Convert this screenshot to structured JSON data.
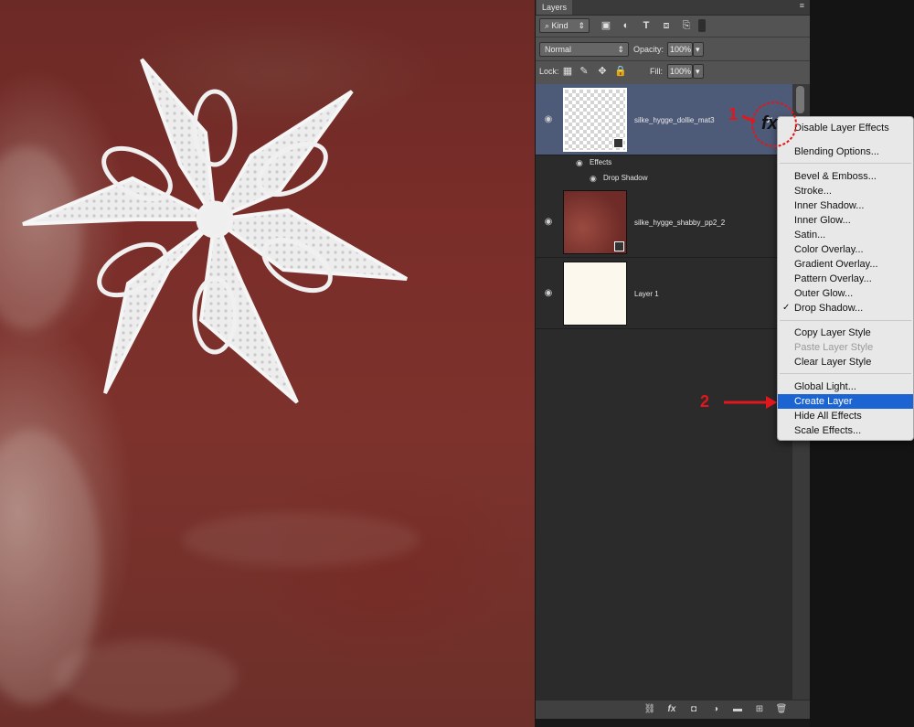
{
  "panel": {
    "tab_label": "Layers",
    "menu_glyph": "≡",
    "filter": {
      "kind_label": "Kind",
      "icons": [
        "image-filter-icon",
        "adjustment-filter-icon",
        "type-filter-icon",
        "shape-filter-icon",
        "smart-object-filter-icon",
        "filter-toggle-icon"
      ]
    },
    "blend_mode": "Normal",
    "opacity_label": "Opacity:",
    "opacity_value": "100%",
    "lock_label": "Lock:",
    "fill_label": "Fill:",
    "fill_value": "100%"
  },
  "layers": [
    {
      "name": "silke_hygge_dollie_mat3",
      "selected": true,
      "fx_label": "fx",
      "effects_label": "Effects",
      "effect_items": [
        "Drop Shadow"
      ]
    },
    {
      "name": "silke_hygge_shabby_pp2_2",
      "selected": false
    },
    {
      "name": "Layer 1",
      "selected": false
    }
  ],
  "context_menu": {
    "items": [
      {
        "label": "Disable Layer Effects"
      },
      {
        "label": "Blending Options..."
      },
      {
        "label": "Bevel & Emboss..."
      },
      {
        "label": "Stroke..."
      },
      {
        "label": "Inner Shadow..."
      },
      {
        "label": "Inner Glow..."
      },
      {
        "label": "Satin..."
      },
      {
        "label": "Color Overlay..."
      },
      {
        "label": "Gradient Overlay..."
      },
      {
        "label": "Pattern Overlay..."
      },
      {
        "label": "Outer Glow..."
      },
      {
        "label": "Drop Shadow...",
        "checked": true
      },
      {
        "label": "Copy Layer Style"
      },
      {
        "label": "Paste Layer Style",
        "disabled": true
      },
      {
        "label": "Clear Layer Style"
      },
      {
        "label": "Global Light..."
      },
      {
        "label": "Create Layer",
        "highlighted": true
      },
      {
        "label": "Hide All Effects"
      },
      {
        "label": "Scale Effects..."
      }
    ],
    "check_glyph": "✓"
  },
  "annotations": {
    "step1": "1",
    "step2": "2",
    "fx_badge": "fx",
    "arrow_color": "#e3161b"
  },
  "colors": {
    "highlight": "#1c64d1",
    "selected_layer": "#4d5a78",
    "canvas_red": "#7a2d29"
  }
}
